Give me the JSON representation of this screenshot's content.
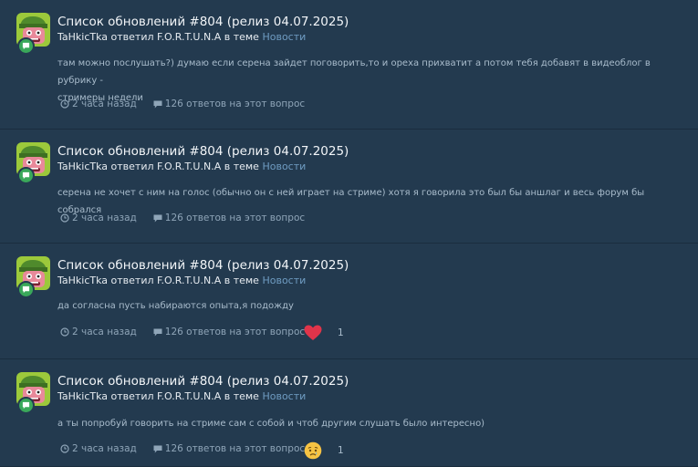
{
  "entries": [
    {
      "title": "Список обновлений #804 (релиз 04.07.2025)",
      "author": "TaHkicTka",
      "action": " ответил ",
      "target": "F.O.R.T.U.N.A",
      "in_topic": " в теме ",
      "forum": "Новости",
      "body_line1": "там можно послушать?) думаю если серена зайдет поговорить,то и ореха прихватит а потом тебя добавят в видеоблог в рубрику -",
      "body_line2": "стримеры недели",
      "time": "2 часа назад",
      "replies": "126 ответов на этот вопрос",
      "reaction": null
    },
    {
      "title": "Список обновлений #804 (релиз 04.07.2025)",
      "author": "TaHkicTka",
      "action": " ответил ",
      "target": "F.O.R.T.U.N.A",
      "in_topic": " в теме ",
      "forum": "Новости",
      "body_line1": "серена не хочет с ним на голос (обычно он с ней играет на стриме) хотя я говорила это был бы аншлаг и весь форум бы собрался",
      "body_line2": "",
      "time": "2 часа назад",
      "replies": "126 ответов на этот вопрос",
      "reaction": null
    },
    {
      "title": "Список обновлений #804 (релиз 04.07.2025)",
      "author": "TaHkicTka",
      "action": " ответил ",
      "target": "F.O.R.T.U.N.A",
      "in_topic": " в теме ",
      "forum": "Новости",
      "body_line1": "да согласна пусть набираются опыта,я подожду",
      "body_line2": "",
      "time": "2 часа назад",
      "replies": "126 ответов на этот вопрос",
      "reaction": {
        "icon": "heart-reaction-icon",
        "count": "1"
      }
    },
    {
      "title": "Список обновлений #804 (релиз 04.07.2025)",
      "author": "TaHkicTka",
      "action": " ответил ",
      "target": "F.O.R.T.U.N.A",
      "in_topic": " в теме ",
      "forum": "Новости",
      "body_line1": "а ты попробуй говорить на стриме сам с собой и чтоб другим слушать было интересно)",
      "body_line2": "",
      "time": "2 часа назад",
      "replies": "126 ответов на этот вопрос",
      "reaction": {
        "icon": "sad-reaction-icon",
        "count": "1"
      }
    }
  ],
  "icons": {
    "avatar": "cartoon-soldier-avatar",
    "badge": "chat-bubble-icon",
    "time": "clock-icon",
    "replies": "comment-icon"
  },
  "colors": {
    "background": "#233a4f",
    "link": "#6f9cc2",
    "badge": "#3aa85a",
    "heart": "#e0344a"
  }
}
